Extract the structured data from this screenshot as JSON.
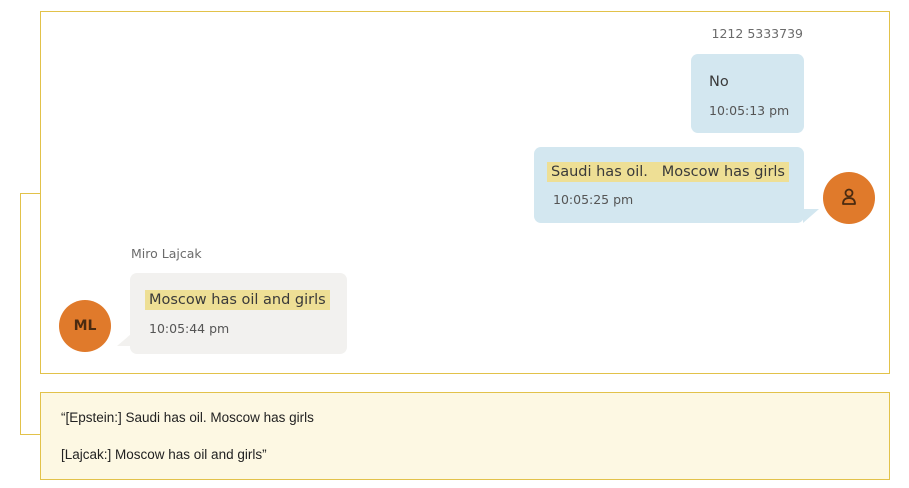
{
  "conversation": {
    "sender_number": "1212 5333739",
    "messages": [
      {
        "direction": "outgoing",
        "text": "No",
        "time": "10:05:13 pm",
        "highlighted": false
      },
      {
        "direction": "outgoing",
        "text": "Saudi has oil.   Moscow has girls",
        "time": "10:05:25 pm",
        "highlighted": true
      },
      {
        "direction": "incoming",
        "text": "Moscow has oil and girls",
        "time": "10:05:44 pm",
        "highlighted": true
      }
    ],
    "contact_name": "Miro Lajcak",
    "contact_initials": "ML",
    "self_avatar_icon": "person-icon",
    "accent_color": "#e07a2b",
    "highlight_color": "#eedf95"
  },
  "caption": {
    "lines": [
      "“[Epstein:] Saudi has oil. Moscow has girls",
      "[Lajcak:] Moscow has oil and girls”"
    ],
    "border_color": "#e2c24a",
    "background_color": "#fdf8e3"
  }
}
